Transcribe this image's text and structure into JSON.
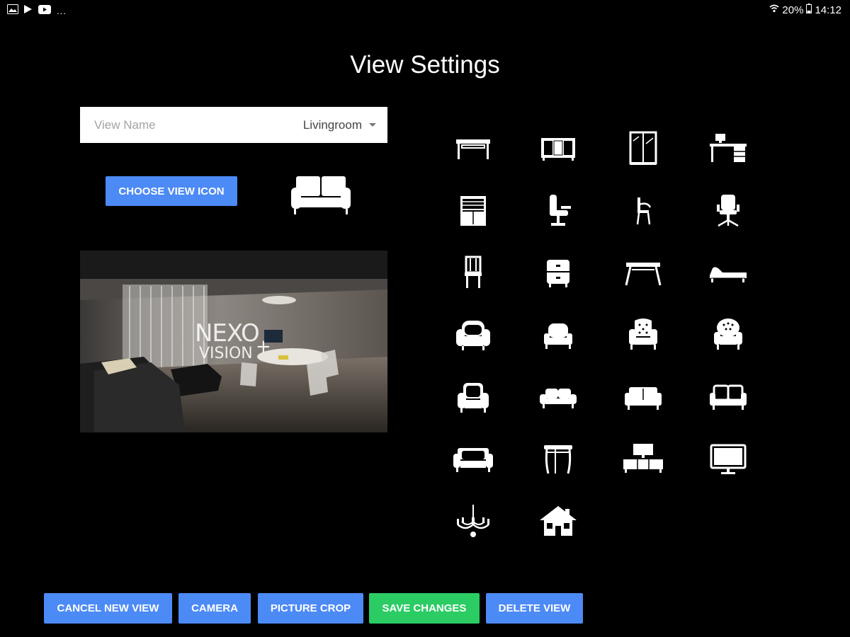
{
  "status_bar": {
    "left_icons": [
      "gallery-icon",
      "play-store-icon",
      "youtube-icon"
    ],
    "overflow": "...",
    "battery": "20%",
    "time": "14:12"
  },
  "title": "View Settings",
  "view_name": {
    "placeholder": "View Name",
    "value": "Livingroom"
  },
  "choose_icon_label": "CHOOSE VIEW ICON",
  "selected_icon": "sofa-icon",
  "preview_image": {
    "watermark_line1": "NEXO",
    "watermark_line2": "VISION"
  },
  "icon_grid": [
    "desk-table-icon",
    "sideboard-icon",
    "glass-cabinet-icon",
    "computer-desk-icon",
    "bookshelf-cabinet-icon",
    "barber-chair-icon",
    "armchair-chair-icon",
    "office-chair-icon",
    "dining-chair-icon",
    "nightstand-icon",
    "coffee-table-icon",
    "chaise-lounge-icon",
    "club-armchair-icon",
    "small-armchair-icon",
    "wingback-chair-icon",
    "tufted-armchair-icon",
    "lounge-armchair-icon",
    "loveseat-icon",
    "sofa-icon",
    "sectional-sofa-icon",
    "couch-icon",
    "side-table-icon",
    "tv-stand-icon",
    "tv-monitor-icon",
    "chandelier-icon",
    "house-icon"
  ],
  "buttons": {
    "cancel": "CANCEL NEW VIEW",
    "camera": "CAMERA",
    "crop": "PICTURE CROP",
    "save": "SAVE CHANGES",
    "delete": "DELETE VIEW"
  },
  "colors": {
    "background": "#000000",
    "primary_button": "#4c8af6",
    "save_button": "#2bcc63"
  }
}
